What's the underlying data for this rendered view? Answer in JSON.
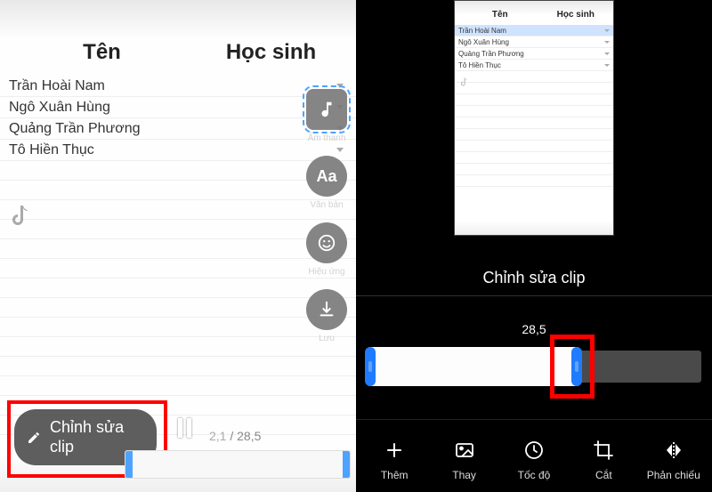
{
  "sheet": {
    "headers": {
      "col1": "Tên",
      "col2": "Học sinh"
    },
    "rows": [
      {
        "name": "Trần Hoài Nam"
      },
      {
        "name": "Ngô Xuân Hùng"
      },
      {
        "name": "Quảng Trần Phương"
      },
      {
        "name": "Tô Hiền Thục"
      }
    ]
  },
  "side_tools": {
    "music": "Âm thanh",
    "text": "Văn bản",
    "effect": "Hiệu ứng",
    "download": "Lưu"
  },
  "edit_button_label": "Chỉnh sửa clip",
  "playback": {
    "current": "2,1",
    "total": "28,5",
    "sep": " / "
  },
  "right": {
    "title": "Chỉnh sửa clip",
    "duration": "28,5",
    "tools": {
      "add": "Thêm",
      "replace": "Thay",
      "speed": "Tốc độ",
      "crop": "Cắt",
      "mirror": "Phản chiếu"
    }
  }
}
